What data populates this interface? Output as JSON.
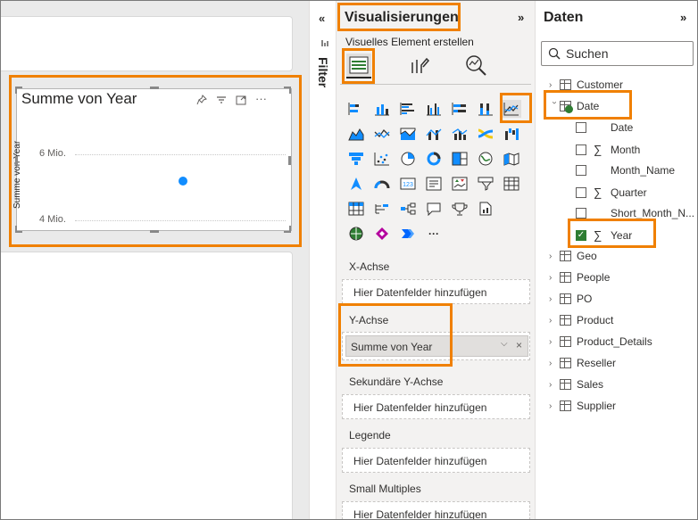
{
  "report": {
    "visual": {
      "title": "Summe von Year",
      "y_axis_title": "Summe von Year",
      "ticks": [
        "6 Mio.",
        "4 Mio."
      ]
    }
  },
  "filter_pane": {
    "label": "Filter"
  },
  "viz_pane": {
    "title": "Visualisierungen",
    "subtitle": "Visuelles Element erstellen",
    "more": "···",
    "wells": [
      {
        "label": "X-Achse",
        "value": "Hier Datenfelder hinzufügen"
      },
      {
        "label": "Y-Achse",
        "value": "Summe von Year"
      },
      {
        "label": "Sekundäre Y-Achse",
        "value": "Hier Datenfelder hinzufügen"
      },
      {
        "label": "Legende",
        "value": "Hier Datenfelder hinzufügen"
      },
      {
        "label": "Small Multiples",
        "value": "Hier Datenfelder hinzufügen"
      }
    ],
    "clear": "×",
    "dropdown": "⌵"
  },
  "data_pane": {
    "title": "Daten",
    "search_placeholder": "Suchen",
    "tables": [
      "Customer",
      "Date",
      "Geo",
      "People",
      "PO",
      "Product",
      "Product_Details",
      "Reseller",
      "Sales",
      "Supplier"
    ],
    "date_fields": [
      "Date",
      "Month",
      "Month_Name",
      "Quarter",
      "Short_Month_N...",
      "Year"
    ]
  },
  "colors": {
    "accent": "#118dff",
    "highlight": "#f08000",
    "check": "#2e7d32"
  }
}
